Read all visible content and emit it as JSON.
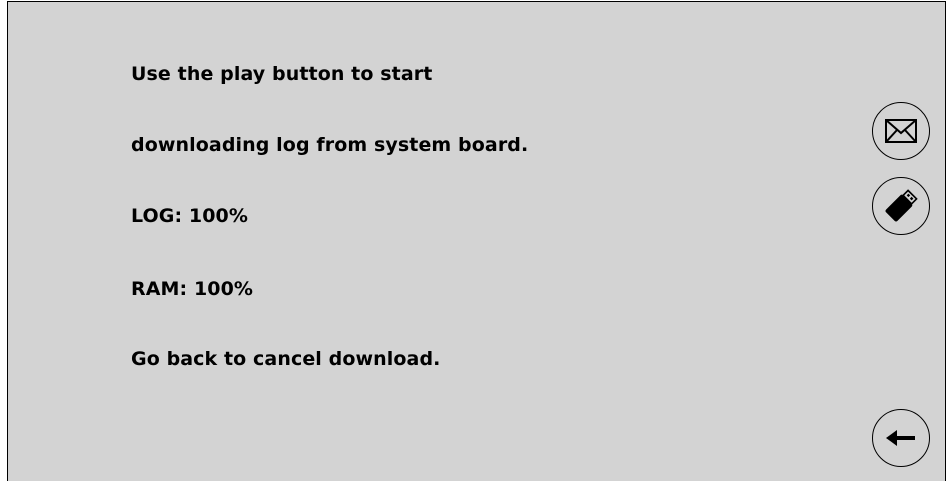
{
  "instructions": {
    "line1": "Use the play button to start",
    "line2": "downloading log from system board.",
    "log_status": "LOG: 100%",
    "ram_status": "RAM: 100%",
    "cancel_hint": "Go back to cancel download."
  },
  "progress": {
    "log_percent": 100,
    "ram_percent": 100
  },
  "buttons": {
    "email": {
      "icon": "envelope-icon"
    },
    "usb": {
      "icon": "usb-stick-icon"
    },
    "back": {
      "icon": "arrow-left-icon"
    }
  },
  "colors": {
    "background": "#d3d3d3",
    "text": "#000000"
  }
}
